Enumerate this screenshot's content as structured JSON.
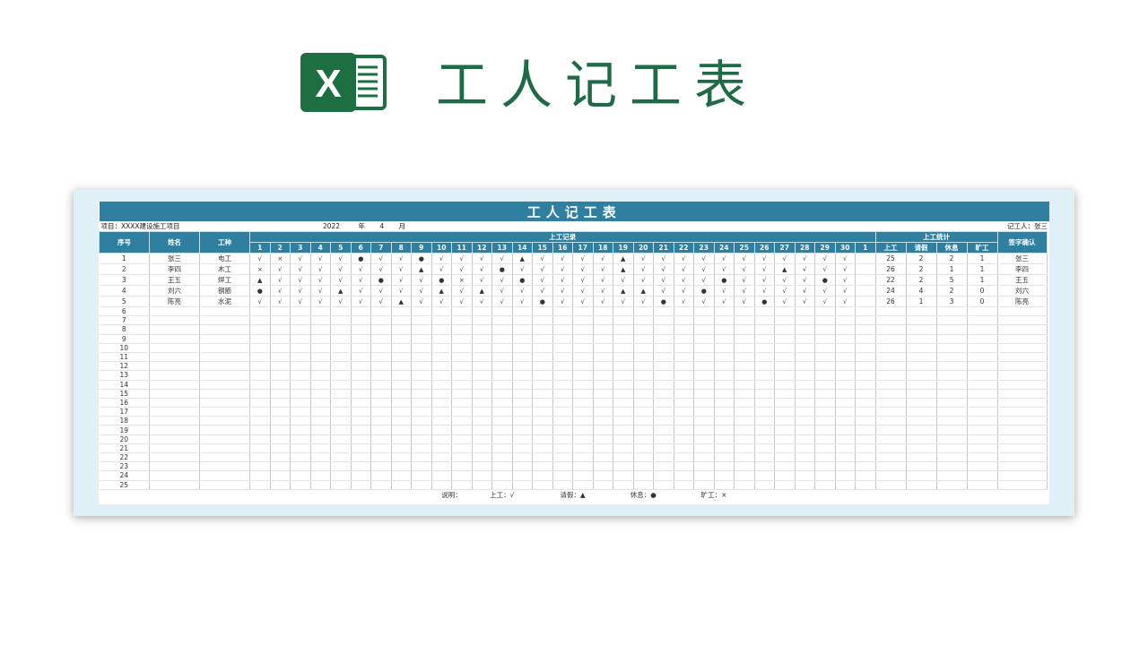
{
  "hero": {
    "title": "工人记工表",
    "logo_letter": "X"
  },
  "sheet": {
    "title": "工人记工表",
    "project_label": "项目：XXXX建设施工项目",
    "year": "2022",
    "year_unit": "年",
    "month": "4",
    "month_unit": "月",
    "recorder": "记工人：张三",
    "headers": {
      "seq": "序号",
      "name": "姓名",
      "trade": "工种",
      "record_group": "上工记录",
      "stats_group": "上工统计",
      "stat_cols": [
        "上工",
        "请假",
        "休息",
        "旷工"
      ],
      "sign": "签字确认"
    },
    "days": [
      "1",
      "2",
      "3",
      "4",
      "5",
      "6",
      "7",
      "8",
      "9",
      "10",
      "11",
      "12",
      "13",
      "14",
      "15",
      "16",
      "17",
      "18",
      "19",
      "20",
      "21",
      "22",
      "23",
      "24",
      "25",
      "26",
      "27",
      "28",
      "29",
      "30",
      "1"
    ],
    "rows": [
      {
        "seq": "1",
        "name": "张三",
        "trade": "电工",
        "marks": "√×√√√●√√●√√√√▲√√√√▲√√√√√√√√√√√ ",
        "stats": [
          "25",
          "2",
          "2",
          "1"
        ],
        "sign": "张三"
      },
      {
        "seq": "2",
        "name": "李四",
        "trade": "木工",
        "marks": "×√√√√√√√▲√√√●√√√√√▲√√√√√√√▲√√√ ",
        "stats": [
          "26",
          "2",
          "1",
          "1"
        ],
        "sign": "李四"
      },
      {
        "seq": "3",
        "name": "王五",
        "trade": "焊工",
        "marks": "▲√√√√√●√√●×√√●√√√√√√√√√●√√√√●√ ",
        "stats": [
          "22",
          "2",
          "5",
          "1"
        ],
        "sign": "王五"
      },
      {
        "seq": "4",
        "name": "刘六",
        "trade": "钢筋",
        "marks": "●√√√▲√√√√▲√▲√√√√√√▲▲√√●√√√√√√√ ",
        "stats": [
          "24",
          "4",
          "2",
          "0"
        ],
        "sign": "刘六"
      },
      {
        "seq": "5",
        "name": "陈亮",
        "trade": "水泥",
        "marks": "√√√√√√√▲√√√√√√●√√√√√●√√√√●√√√√ ",
        "stats": [
          "26",
          "1",
          "3",
          "0"
        ],
        "sign": "陈亮"
      }
    ],
    "empty_seqs": [
      "6",
      "7",
      "8",
      "9",
      "10",
      "11",
      "12",
      "13",
      "14",
      "15",
      "16",
      "17",
      "18",
      "19",
      "20",
      "21",
      "22",
      "23",
      "24",
      "25"
    ],
    "legend": {
      "intro": "说明：",
      "work": "上工：√",
      "leave": "请假：▲",
      "rest": "休息：●",
      "absent": "旷工：×"
    }
  },
  "colors": {
    "header_blue": "#2e7fa0",
    "hero_green": "#1e6b45",
    "excel_green": "#1d6f42"
  }
}
